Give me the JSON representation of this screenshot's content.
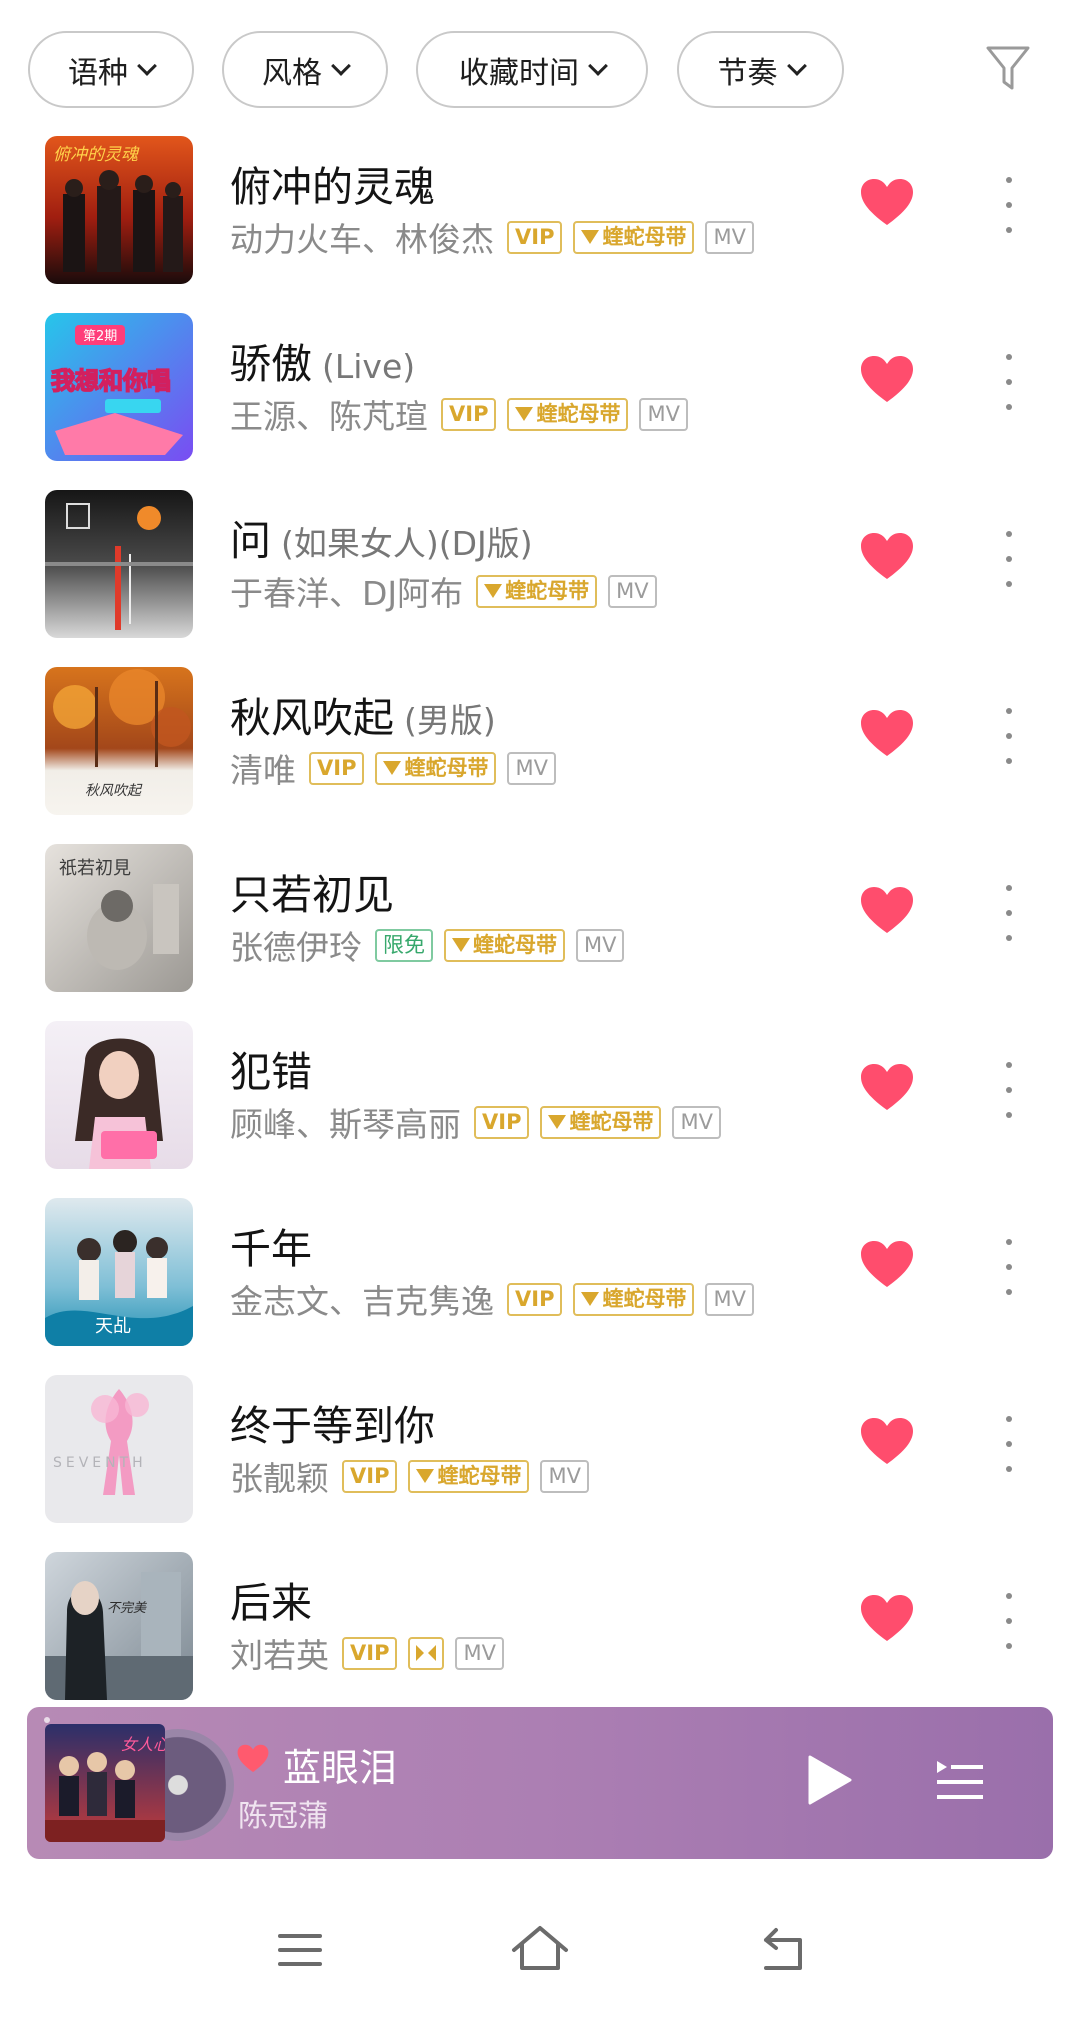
{
  "filters": [
    {
      "label": "语种"
    },
    {
      "label": "风格"
    },
    {
      "label": "收藏时间"
    },
    {
      "label": "节奏"
    }
  ],
  "filter_icon": "funnel-icon",
  "badges": {
    "vip": "VIP",
    "free": "限免",
    "tape": "蝰蛇母带",
    "mv": "MV"
  },
  "songs": [
    {
      "title": "俯冲的灵魂",
      "version": "",
      "artist": "动力火车、林俊杰"
    },
    {
      "title": "骄傲",
      "version": "(Live)",
      "artist": "王源、陈芃瑄"
    },
    {
      "title": "问",
      "version": "(如果女人)(DJ版)",
      "artist": "于春洋、DJ阿布"
    },
    {
      "title": "秋风吹起",
      "version": "(男版)",
      "artist": "清唯"
    },
    {
      "title": "只若初见",
      "version": "",
      "artist": "张德伊玲"
    },
    {
      "title": "犯错",
      "version": "",
      "artist": "顾峰、斯琴高丽"
    },
    {
      "title": "千年",
      "version": "",
      "artist": "金志文、吉克隽逸"
    },
    {
      "title": "终于等到你",
      "version": "",
      "artist": "张靓颖"
    },
    {
      "title": "后来",
      "version": "",
      "artist": "刘若英"
    }
  ],
  "cover_art_text": {
    "song1": "俯冲的灵魂",
    "song2_badge": "第2期",
    "song2": "我想和你唱",
    "song4": "秋风吹起",
    "song5": "祇若初見",
    "song7": "天乩",
    "song8": "SEVENTH",
    "song9": "不完美"
  },
  "player": {
    "title": "蓝眼泪",
    "artist": "陈冠蒲",
    "cover_text": "女人心"
  },
  "colors": {
    "heart": "#ff4d6d",
    "vip_gold": "#d9a72d",
    "free_green": "#37a86c",
    "player_bg": "#ac7fb3"
  },
  "nav": {
    "menu": "menu-icon",
    "home": "home-icon",
    "back": "back-icon"
  }
}
